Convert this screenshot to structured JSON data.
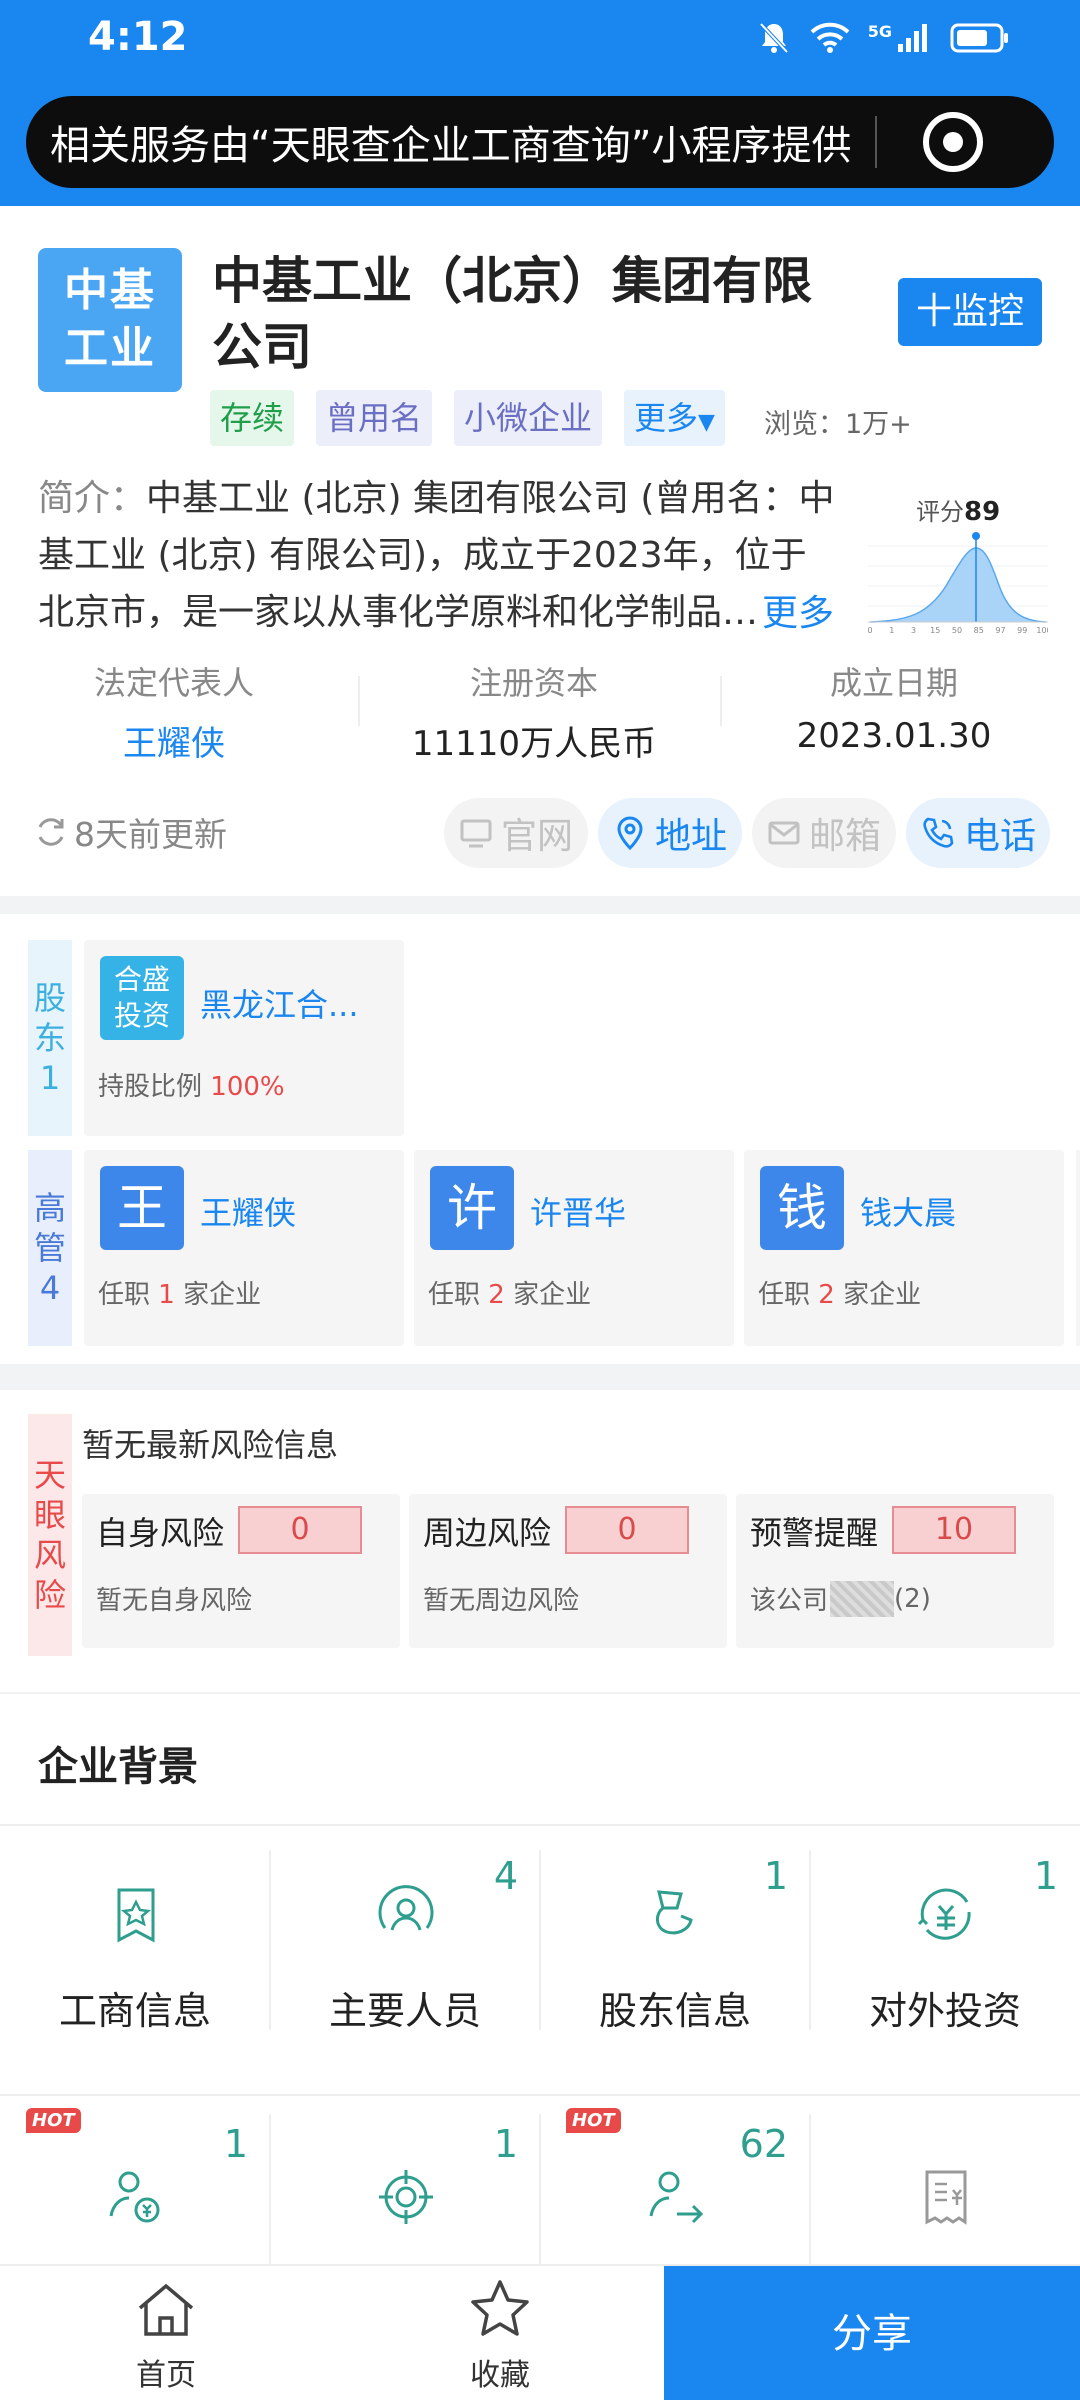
{
  "status_bar": {
    "time": "4:12",
    "network": "5G"
  },
  "banner": {
    "text": "相关服务由“天眼查企业工商查询”小程序提供"
  },
  "company": {
    "logo_line1": "中基",
    "logo_line2": "工业",
    "name": "中基工业（北京）集团有限公司",
    "monitor_label": "十监控",
    "tags": {
      "status": "存续",
      "former_name": "曾用名",
      "size": "小微企业",
      "more": "更多"
    },
    "views": "浏览：1万+",
    "intro_label": "简介：",
    "intro_text": "中基工业 (北京) 集团有限公司 (曾用名：中基工业 (北京) 有限公司)，成立于2023年，位于北京市，是一家以从事化学原料和化学制品…",
    "intro_more": "更多",
    "score_label": "评分",
    "score_value": "89",
    "score_axis": [
      "0",
      "1",
      "3",
      "15",
      "50",
      "85",
      "97",
      "99",
      "100"
    ],
    "stats": [
      {
        "title": "法定代表人",
        "value": "王耀侠"
      },
      {
        "title": "注册资本",
        "value": "11110万人民币"
      },
      {
        "title": "成立日期",
        "value": "2023.01.30"
      }
    ],
    "updated": "8天前更新",
    "contacts": {
      "web": "官网",
      "address": "地址",
      "email": "邮箱",
      "phone": "电话"
    }
  },
  "shareholders": {
    "tab": [
      "股",
      "东",
      "1"
    ],
    "items": [
      {
        "logo_line1": "合盛",
        "logo_line2": "投资",
        "name": "黑龙江合...",
        "ratio_label": "持股比例",
        "ratio": "100%"
      }
    ]
  },
  "executives": {
    "tab": [
      "高",
      "管",
      "4"
    ],
    "items": [
      {
        "avatar": "王",
        "name": "王耀侠",
        "jobs_prefix": "任职",
        "count": "1",
        "jobs_suffix": "家企业"
      },
      {
        "avatar": "许",
        "name": "许晋华",
        "jobs_prefix": "任职",
        "count": "2",
        "jobs_suffix": "家企业"
      },
      {
        "avatar": "钱",
        "name": "钱大晨",
        "jobs_prefix": "任职",
        "count": "2",
        "jobs_suffix": "家企业"
      }
    ]
  },
  "risk": {
    "tab": [
      "天",
      "眼",
      "风",
      "险"
    ],
    "none_text": "暂无最新风险信息",
    "items": [
      {
        "title": "自身风险",
        "value": "0",
        "sub": "暂无自身风险"
      },
      {
        "title": "周边风险",
        "value": "0",
        "sub": "暂无周边风险"
      },
      {
        "title": "预警提醒",
        "value": "10",
        "sub_prefix": "该公司",
        "sub_suffix": "(2)"
      }
    ]
  },
  "background": {
    "title": "企业背景",
    "row1": [
      {
        "label": "工商信息",
        "count": "",
        "icon": "shield-star-icon"
      },
      {
        "label": "主要人员",
        "count": "4",
        "icon": "person-circle-icon"
      },
      {
        "label": "股东信息",
        "count": "1",
        "icon": "shareholder-icon"
      },
      {
        "label": "对外投资",
        "count": "1",
        "icon": "investment-icon"
      }
    ],
    "row2": [
      {
        "hot": "HOT",
        "count": "1",
        "icon": "person-money-icon"
      },
      {
        "hot": "",
        "count": "1",
        "icon": "target-icon"
      },
      {
        "hot": "HOT",
        "count": "62",
        "icon": "person-arrow-icon"
      },
      {
        "hot": "",
        "count": "",
        "icon": "receipt-icon"
      }
    ]
  },
  "bottom_nav": {
    "home": "首页",
    "favorite": "收藏",
    "share": "分享"
  },
  "colors": {
    "primary": "#1a86f0",
    "risk_red": "#e84a4a",
    "teal": "#2e9e8e"
  }
}
